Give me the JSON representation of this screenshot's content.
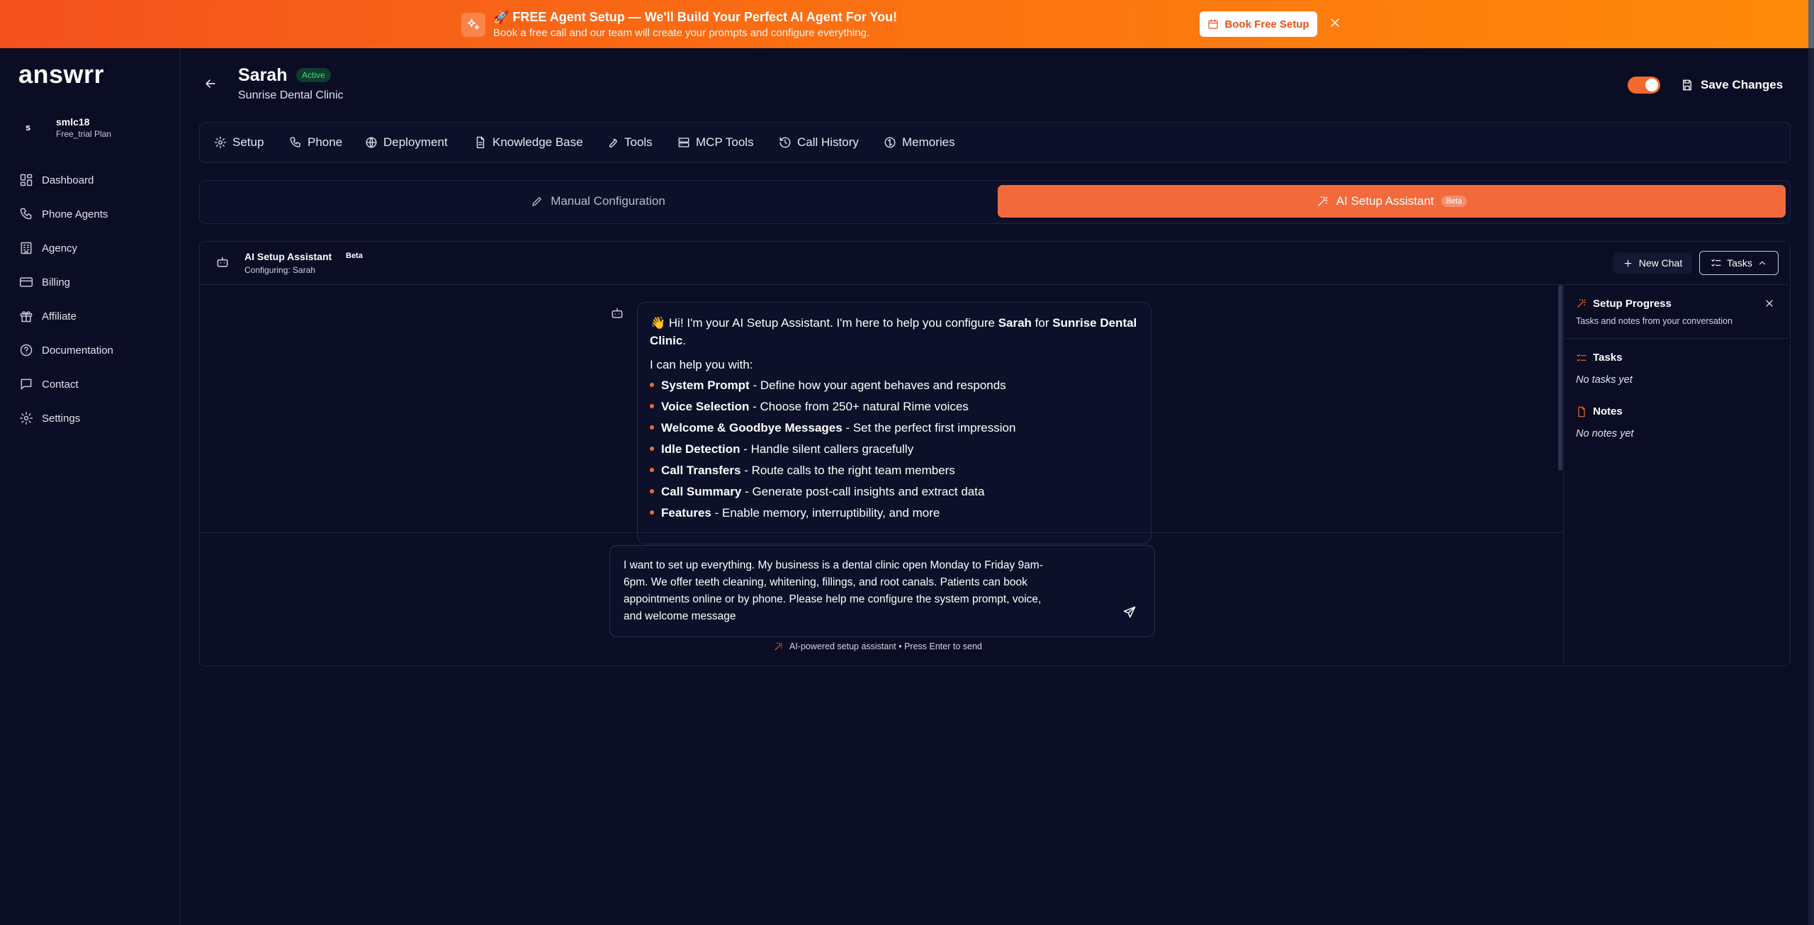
{
  "banner": {
    "title": "🚀 FREE Agent Setup — We'll Build Your Perfect AI Agent For You!",
    "subtitle": "Book a free call and our team will create your prompts and configure everything.",
    "button_label": "Book Free Setup"
  },
  "sidebar": {
    "logo": "answrr",
    "user": {
      "avatar_letter": "s",
      "name": "smlc18",
      "plan": "Free_trial Plan"
    },
    "items": [
      {
        "label": "Dashboard",
        "icon": "grid-icon"
      },
      {
        "label": "Phone Agents",
        "icon": "phone-icon"
      },
      {
        "label": "Agency",
        "icon": "building-icon"
      },
      {
        "label": "Billing",
        "icon": "credit-card-icon"
      },
      {
        "label": "Affiliate",
        "icon": "gift-icon"
      },
      {
        "label": "Documentation",
        "icon": "help-circle-icon"
      },
      {
        "label": "Contact",
        "icon": "message-icon"
      },
      {
        "label": "Settings",
        "icon": "gear-icon"
      }
    ]
  },
  "header": {
    "agent_name": "Sarah",
    "status": "Active",
    "business": "Sunrise Dental Clinic",
    "save_label": "Save Changes"
  },
  "tabs": [
    {
      "label": "Setup",
      "icon": "gear-icon"
    },
    {
      "label": "Phone",
      "icon": "phone-icon"
    },
    {
      "label": "Deployment",
      "icon": "globe-icon"
    },
    {
      "label": "Knowledge Base",
      "icon": "file-icon"
    },
    {
      "label": "Tools",
      "icon": "wrench-icon"
    },
    {
      "label": "MCP Tools",
      "icon": "server-icon"
    },
    {
      "label": "Call History",
      "icon": "history-icon"
    },
    {
      "label": "Memories",
      "icon": "brain-icon"
    }
  ],
  "mode": {
    "manual_label": "Manual Configuration",
    "ai_label": "AI Setup Assistant",
    "ai_badge": "Beta"
  },
  "assistant": {
    "title": "AI Setup Assistant",
    "badge": "Beta",
    "subtitle": "Configuring: Sarah",
    "new_chat_label": "New Chat",
    "tasks_label": "Tasks"
  },
  "message": {
    "greeting_pre": "Hi! I'm your AI Setup Assistant. I'm here to help you configure",
    "greeting_agent": "Sarah",
    "greeting_for": "for",
    "greeting_business_a": "Sunrise Dental",
    "greeting_business_b": "Clinic",
    "help_intro": "I can help you with:",
    "features": [
      {
        "name": "System Prompt",
        "desc": "- Define how your agent behaves and responds"
      },
      {
        "name": "Voice Selection",
        "desc": "- Choose from 250+ natural Rime voices"
      },
      {
        "name": "Welcome & Goodbye Messages",
        "desc": "- Set the perfect first impression"
      },
      {
        "name": "Idle Detection",
        "desc": "- Handle silent callers gracefully"
      },
      {
        "name": "Call Transfers",
        "desc": "- Route calls to the right team members"
      },
      {
        "name": "Call Summary",
        "desc": "- Generate post-call insights and extract data"
      },
      {
        "name": "Features",
        "desc": "- Enable memory, interruptibility, and more"
      }
    ]
  },
  "chat_input": {
    "value": "I want to set up everything. My business is a dental clinic open Monday to Friday 9am-\n6pm. We offer teeth cleaning, whitening, fillings, and root canals. Patients can book\nappointments online or by phone. Please help me configure the system prompt, voice,\nand welcome message",
    "hint": "AI-powered setup assistant • Press Enter to send"
  },
  "progress": {
    "title": "Setup Progress",
    "subtitle": "Tasks and notes from your conversation",
    "tasks_label": "Tasks",
    "tasks_empty": "No tasks yet",
    "notes_label": "Notes",
    "notes_empty": "No notes yet"
  },
  "colors": {
    "accent": "#f26a2e",
    "background": "#0a0d24",
    "active_badge": "#3ddc84"
  }
}
